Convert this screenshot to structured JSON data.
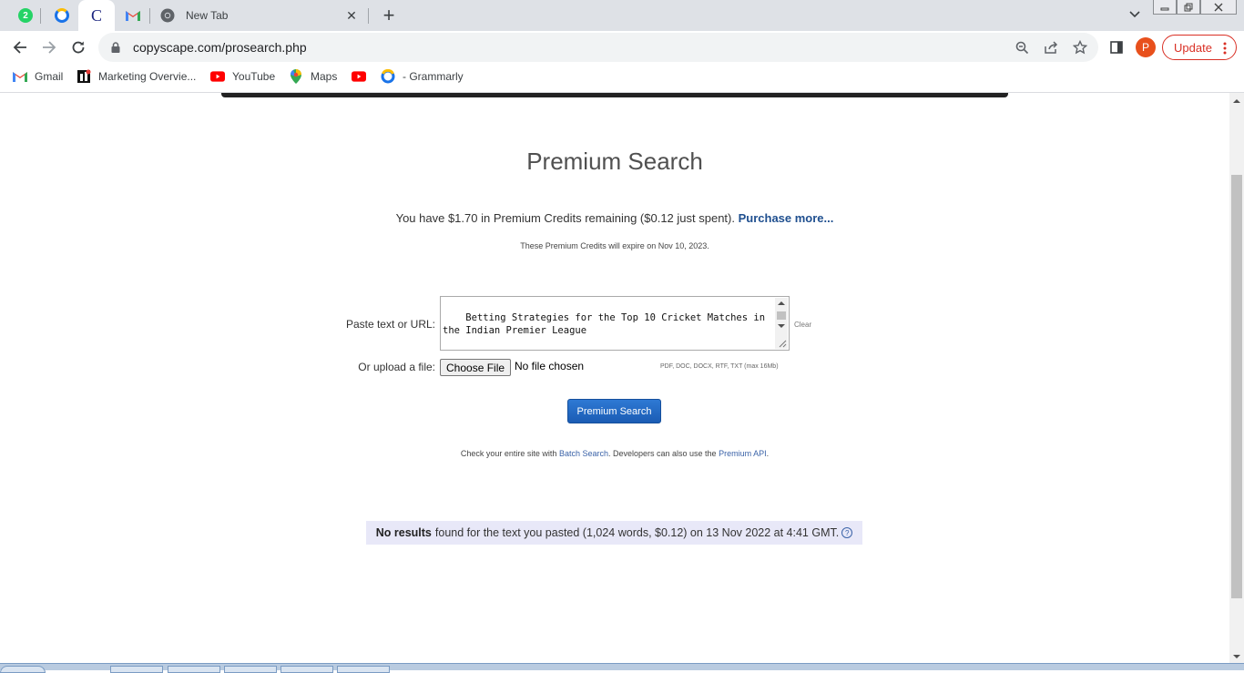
{
  "tabs": {
    "items": [
      {
        "id": "tab-whatsapp",
        "icon": "whatsapp-icon",
        "badge": "2"
      },
      {
        "id": "tab-grammarly",
        "icon": "grammarly-icon"
      },
      {
        "id": "tab-copyscape",
        "icon": "copyscape-icon",
        "letter": "C",
        "active": true
      },
      {
        "id": "tab-gmail",
        "icon": "gmail-icon"
      }
    ],
    "new_tab_title": "New Tab",
    "close_glyph": "✕",
    "plus_glyph": "+"
  },
  "toolbar": {
    "url": "copyscape.com/prosearch.php",
    "avatar_letter": "P",
    "update_label": "Update"
  },
  "bookmarks": [
    {
      "label": "Gmail",
      "icon": "gmail-icon"
    },
    {
      "label": "Marketing Overvie...",
      "icon": "marketing-icon"
    },
    {
      "label": "YouTube",
      "icon": "youtube-icon"
    },
    {
      "label": "Maps",
      "icon": "maps-icon"
    },
    {
      "label": "",
      "icon": "youtube-icon"
    },
    {
      "label": "- Grammarly",
      "icon": "grammarly-icon"
    }
  ],
  "page": {
    "heading": "Premium Search",
    "credits_text": "You have $1.70 in Premium Credits remaining ($0.12 just spent).",
    "purchase_link": "Purchase more...",
    "expire_text": "These Premium Credits will expire on Nov 10, 2023.",
    "paste_label": "Paste text or URL:",
    "textarea_value": "Betting Strategies for the Top 10 Cricket Matches in the Indian Premier League\n\nAt some point, everything that happens in the world is",
    "clear_label": "Clear",
    "upload_label": "Or upload a file:",
    "choose_file_label": "Choose File",
    "no_file_label": "No file chosen",
    "file_hint": "PDF, DOC, DOCX, RTF, TXT (max 16Mb)",
    "search_button": "Premium Search",
    "batch_prefix": "Check your entire site with",
    "batch_link": "Batch Search",
    "batch_middle": ". Developers can also use the",
    "api_link": "Premium API",
    "batch_suffix": ".",
    "result_bold": "No results",
    "result_text": "found for the text you pasted (1,024 words, $0.12) on 13 Nov 2022 at 4:41 GMT.",
    "help_glyph": "?"
  }
}
